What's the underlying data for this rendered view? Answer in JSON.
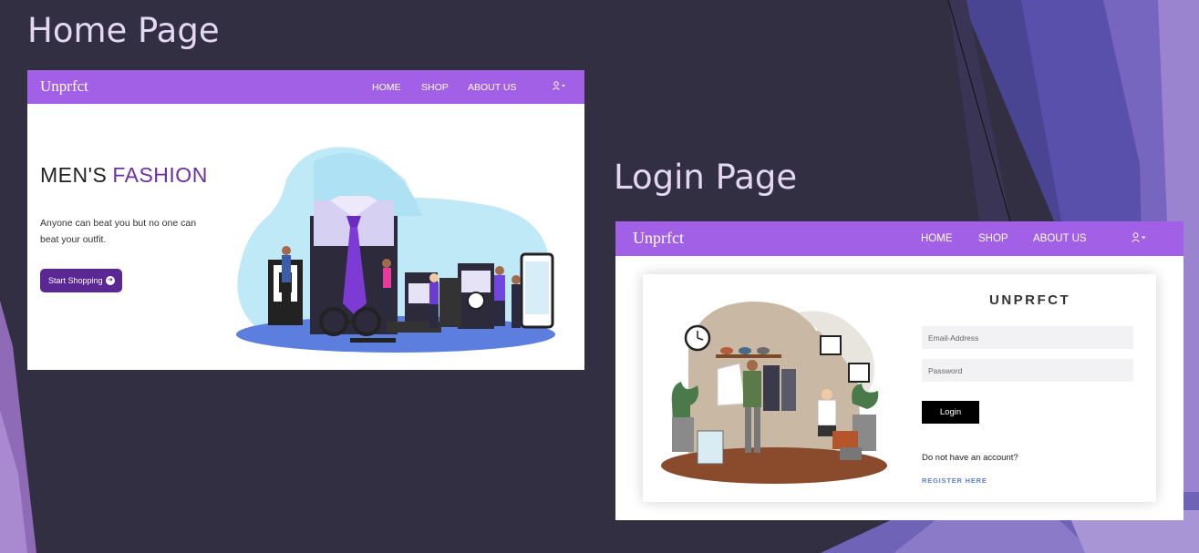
{
  "slide": {
    "home_title": "Home Page",
    "login_title": "Login Page"
  },
  "site": {
    "brand": "Unprfct",
    "nav": {
      "home": "HOME",
      "shop": "SHOP",
      "about": "ABOUT US"
    },
    "user_icon": "user-icon"
  },
  "home": {
    "hero_title_main": "MEN'S",
    "hero_title_accent": "FASHION",
    "hero_text": "Anyone can beat you but no one can beat your outfit.",
    "cta_label": "Start Shopping"
  },
  "login": {
    "card_brand": "UNPRFCT",
    "email_placeholder": "Email-Address",
    "password_placeholder": "Password",
    "login_button": "Login",
    "no_account_text": "Do not have an account?",
    "register_link": "REGISTER HERE"
  },
  "colors": {
    "nav_purple": "#a260e6",
    "accent_purple": "#6d2fa3",
    "cta_purple": "#5b2795",
    "slide_bg": "#332f43",
    "register_blue": "#5b7fd4"
  }
}
